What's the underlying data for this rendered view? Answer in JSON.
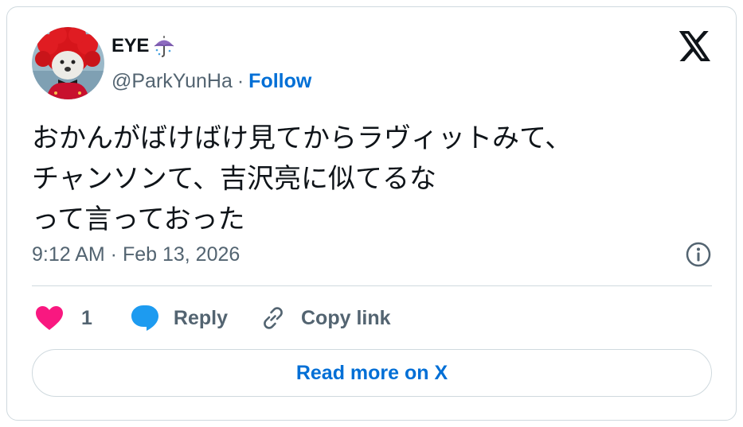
{
  "author": {
    "name": "EYE",
    "handle": "@ParkYunHa",
    "separator": "·",
    "follow_label": "Follow"
  },
  "tweet": {
    "text": "おかんがばけばけ見てからラヴィットみて、\nチャンソンて、吉沢亮に似てるな\nって言っておった",
    "timestamp": "9:12 AM · Feb 13, 2026"
  },
  "actions": {
    "like_count": "1",
    "reply_label": "Reply",
    "copy_label": "Copy link"
  },
  "read_more_label": "Read more on X",
  "colors": {
    "accent": "#006fd6",
    "like": "#f91880",
    "reply": "#1d9bf0",
    "secondary_text": "#536471",
    "border": "#cfd9de"
  },
  "icons": [
    "umbrella-emoji-icon",
    "x-logo-icon",
    "info-icon",
    "heart-icon",
    "reply-bubble-icon",
    "link-icon"
  ]
}
